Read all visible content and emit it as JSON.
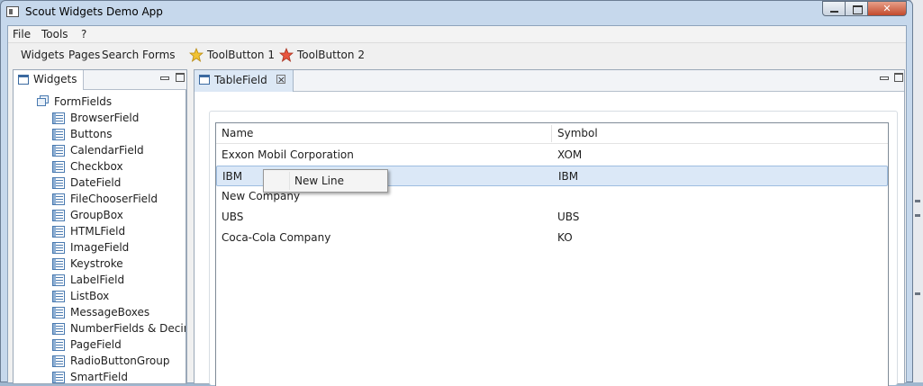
{
  "window": {
    "title": "Scout Widgets Demo App"
  },
  "menubar": [
    "File",
    "Tools",
    "?"
  ],
  "toolbar": {
    "widgets": "Widgets",
    "pages": "Pages",
    "search_forms": "Search Forms",
    "tool_button_1": "ToolButton 1",
    "tool_button_2": "ToolButton 2",
    "star_colors": {
      "tool_button_1": "#f1c232",
      "tool_button_2": "#e8553f"
    }
  },
  "widgets_view": {
    "tab_label": "Widgets",
    "tree": {
      "root": "FormFields",
      "children": [
        "BrowserField",
        "Buttons",
        "CalendarField",
        "Checkbox",
        "DateField",
        "FileChooserField",
        "GroupBox",
        "HTMLField",
        "ImageField",
        "Keystroke",
        "LabelField",
        "ListBox",
        "MessageBoxes",
        "NumberFields & Decima",
        "PageField",
        "RadioButtonGroup",
        "SmartField"
      ]
    }
  },
  "editor": {
    "tab_label": "TableField",
    "table": {
      "columns": [
        "Name",
        "Symbol"
      ],
      "rows": [
        {
          "name": "Exxon Mobil Corporation",
          "symbol": "XOM"
        },
        {
          "name": "IBM",
          "symbol": "IBM",
          "selected": true
        },
        {
          "name": "New Company",
          "symbol": ""
        },
        {
          "name": "UBS",
          "symbol": "UBS"
        },
        {
          "name": "Coca-Cola Company",
          "symbol": "KO"
        }
      ]
    }
  },
  "context_menu": {
    "items": [
      "New Line"
    ]
  }
}
